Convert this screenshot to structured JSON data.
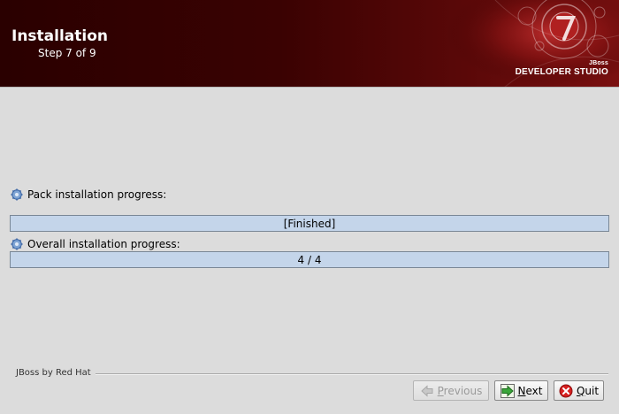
{
  "header": {
    "title": "Installation",
    "step": "Step 7 of 9",
    "brand_small": "JBoss",
    "brand_big": "DEVELOPER STUDIO",
    "colors": {
      "banner_dark": "#2a0000",
      "banner_light": "#7a1010"
    }
  },
  "pack_progress": {
    "label": "Pack installation progress:",
    "text": "[Finished]",
    "value": 1.0,
    "icon": "gear-icon"
  },
  "overall_progress": {
    "label": "Overall installation progress:",
    "text": "4 / 4",
    "value": 1.0,
    "icon": "gear-icon"
  },
  "footer": {
    "vendor": "JBoss by Red Hat",
    "buttons": {
      "previous": {
        "first": "P",
        "rest": "revious",
        "enabled": false,
        "icon": "arrow-left-icon"
      },
      "next": {
        "first": "N",
        "rest": "ext",
        "enabled": true,
        "icon": "arrow-right-icon"
      },
      "quit": {
        "first": "Q",
        "rest": "uit",
        "enabled": true,
        "icon": "stop-icon"
      }
    }
  }
}
